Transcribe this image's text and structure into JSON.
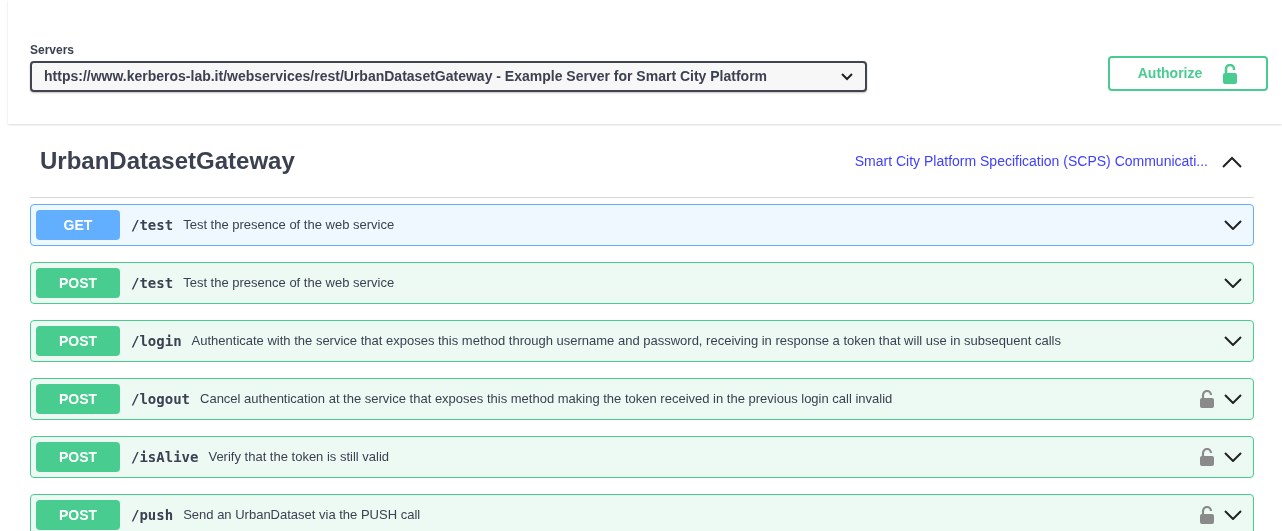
{
  "servers": {
    "label": "Servers",
    "selected_server": "https://www.kerberos-lab.it/webservices/rest/UrbanDatasetGateway - Example Server for Smart City Platform"
  },
  "authorize_button": {
    "label": "Authorize"
  },
  "section": {
    "title": "UrbanDatasetGateway",
    "link": "Smart City Platform Specification (SCPS) Communicati...",
    "expanded": true
  },
  "operations": [
    {
      "method": "GET",
      "path": "/test",
      "summary": "Test the presence of the web service",
      "secured": false
    },
    {
      "method": "POST",
      "path": "/test",
      "summary": "Test the presence of the web service",
      "secured": false
    },
    {
      "method": "POST",
      "path": "/login",
      "summary": "Authenticate with the service that exposes this method through username and password, receiving in response a token that will use in subsequent calls",
      "secured": false
    },
    {
      "method": "POST",
      "path": "/logout",
      "summary": "Cancel authentication at the service that exposes this method making the token received in the previous login call invalid",
      "secured": true
    },
    {
      "method": "POST",
      "path": "/isAlive",
      "summary": "Verify that the token is still valid",
      "secured": true
    },
    {
      "method": "POST",
      "path": "/push",
      "summary": "Send an UrbanDataset via the PUSH call",
      "secured": true
    }
  ]
}
